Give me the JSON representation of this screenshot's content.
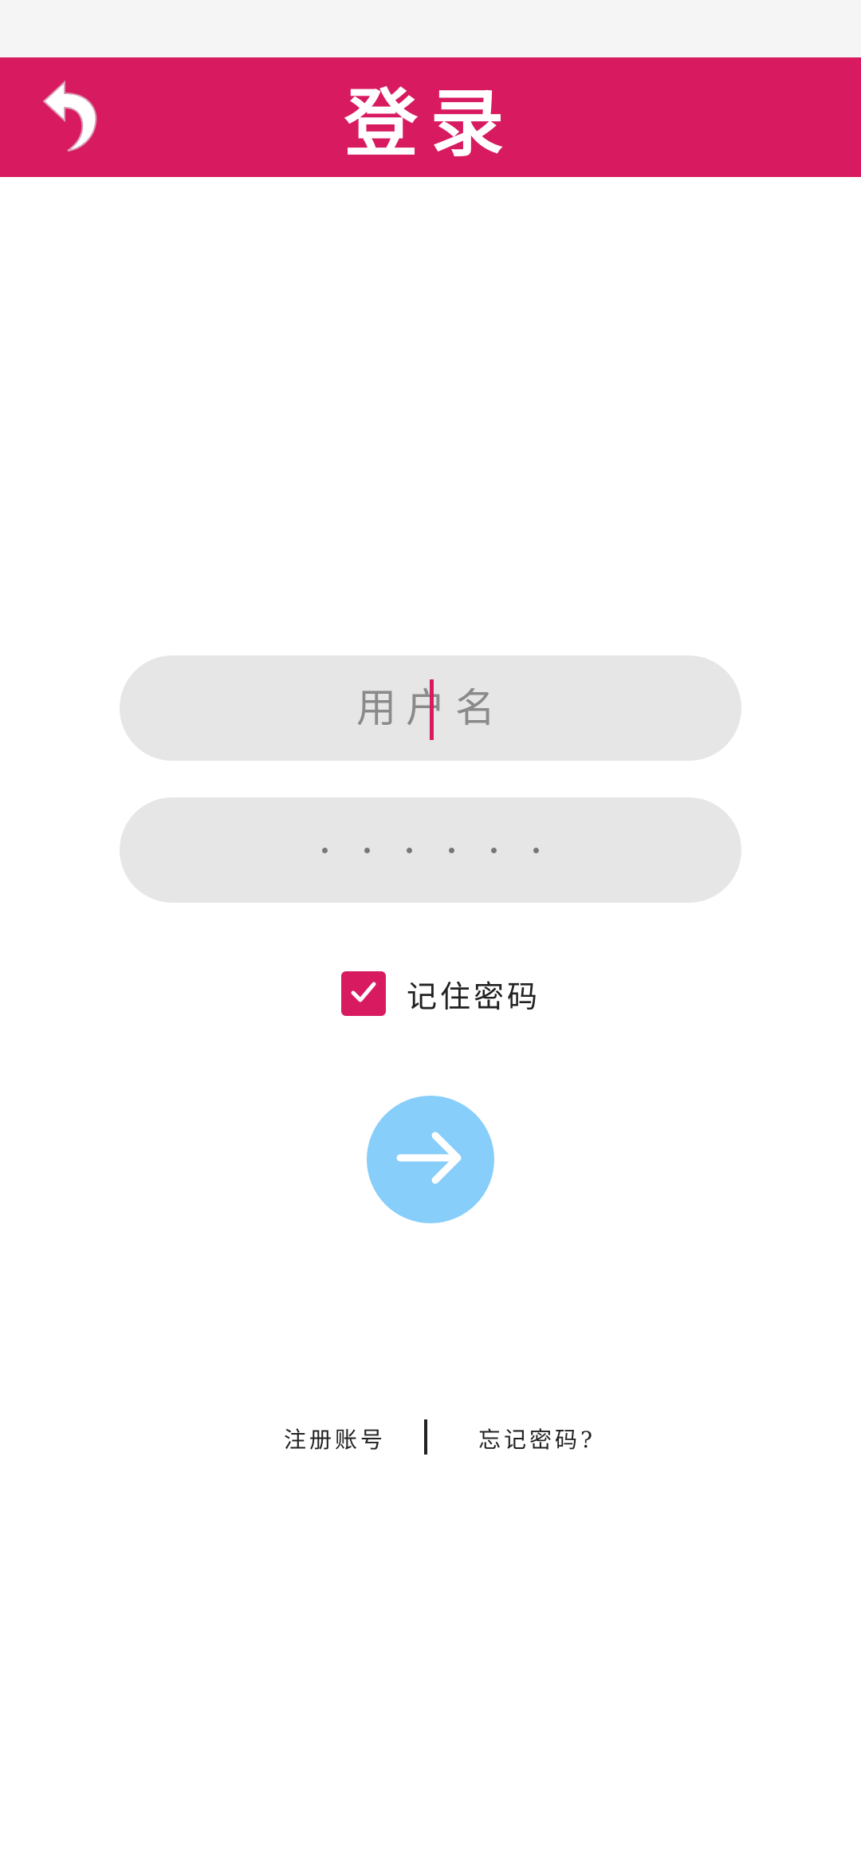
{
  "header": {
    "title": "登录",
    "back_icon": "back-arrow-icon",
    "background_color": "#d81b60"
  },
  "form": {
    "username": {
      "placeholder": "用户名",
      "value": ""
    },
    "password": {
      "placeholder": "",
      "value": "••••••"
    },
    "remember": {
      "label": "记住密码",
      "checked": true,
      "icon": "checkmark-icon"
    },
    "submit": {
      "icon": "arrow-right-icon",
      "color": "#87cefa"
    }
  },
  "links": {
    "register": "注册账号",
    "forgot": "忘记密码?"
  }
}
